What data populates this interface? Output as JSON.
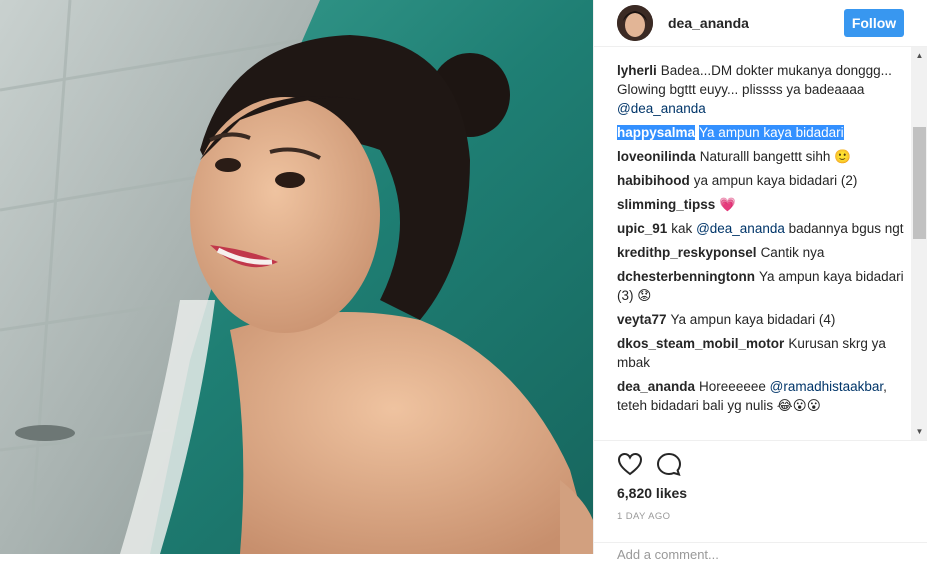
{
  "header": {
    "username": "dea_ananda",
    "follow_label": "Follow"
  },
  "comments": [
    {
      "user": "lyherli",
      "text": "Badea...DM dokter mukanya donggg... Glowing bgttt euyy... plissss ya badeaaaa",
      "mention": "@dea_ananda"
    },
    {
      "user": "happysalma",
      "text": "Ya ampun kaya bidadari",
      "selected": true
    },
    {
      "user": "loveonilinda",
      "text": "Naturalll bangettt sihh 🙂"
    },
    {
      "user": "habibihood",
      "text": "ya ampun kaya bidadari (2)"
    },
    {
      "user": "slimming_tipss",
      "text": "💗"
    },
    {
      "user": "upic_91",
      "text": "kak",
      "mention": "@dea_ananda",
      "text_after": "badannya bgus ngt"
    },
    {
      "user": "kredithp_reskyponsel",
      "text": "Cantik nya"
    },
    {
      "user": "dchesterbenningtonn",
      "text": "Ya ampun kaya bidadari (3) 😟"
    },
    {
      "user": "veyta77",
      "text": "Ya ampun kaya bidadari (4)"
    },
    {
      "user": "dkos_steam_mobil_motor",
      "text": "Kurusan skrg ya mbak"
    },
    {
      "user": "dea_ananda",
      "text": "Horeeeeee",
      "mention": "@ramadhistaakbar",
      "text_after": ", teteh bidadari bali yg nulis 😂😮😮"
    }
  ],
  "actions": {
    "like_icon": "heart-icon",
    "comment_icon": "comment-icon",
    "likes": "6,820 likes",
    "time": "1 DAY AGO",
    "add_comment_placeholder": "Add a comment..."
  },
  "colors": {
    "accent": "#3897f0",
    "mention": "#003569",
    "selection": "#3390ff"
  }
}
